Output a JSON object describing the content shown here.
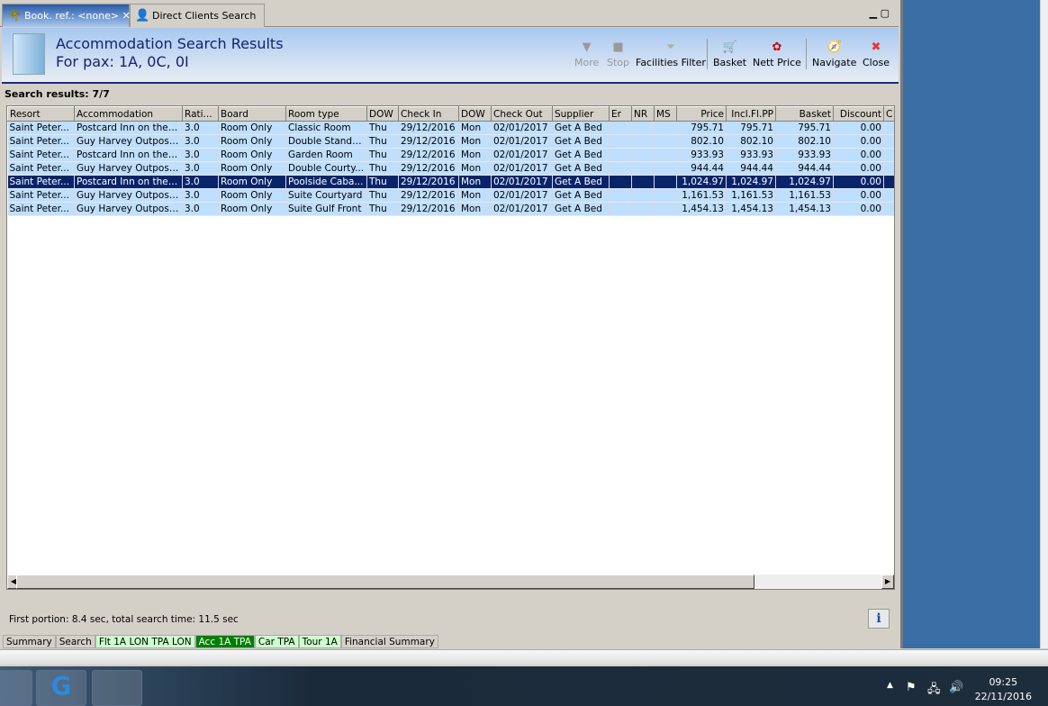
{
  "tabs": [
    {
      "label": "Book. ref.: <none>",
      "close": "✕"
    },
    {
      "label": "Direct Clients Search"
    }
  ],
  "header": {
    "title": "Accommodation Search Results",
    "subtitle": "For pax: 1A, 0C, 0I"
  },
  "toolbar": {
    "more": "More",
    "stop": "Stop",
    "facilities": "Facilities Filter",
    "basket": "Basket",
    "nett": "Nett Price",
    "navigate": "Navigate",
    "close": "Close"
  },
  "results_label": "Search results: 7/7",
  "columns": [
    "Resort",
    "Accommodation",
    "Rati...",
    "Board",
    "Room type",
    "DOW",
    "Check In",
    "DOW",
    "Check Out",
    "Supplier",
    "Er",
    "NR",
    "MS",
    "Price",
    "Incl.Fl.PP",
    "Basket",
    "Discount",
    "C"
  ],
  "rows": [
    [
      "Saint Peter...",
      "Postcard Inn on the ...",
      "3.0",
      "Room Only",
      "Classic Room",
      "Thu",
      "29/12/2016",
      "Mon",
      "02/01/2017",
      "Get A Bed",
      "",
      "",
      "",
      "795.71",
      "795.71",
      "795.71",
      "0.00",
      ""
    ],
    [
      "Saint Peter...",
      "Guy Harvey Outpost ...",
      "3.0",
      "Room Only",
      "Double Standard",
      "Thu",
      "29/12/2016",
      "Mon",
      "02/01/2017",
      "Get A Bed",
      "",
      "",
      "",
      "802.10",
      "802.10",
      "802.10",
      "0.00",
      ""
    ],
    [
      "Saint Peter...",
      "Postcard Inn on the ...",
      "3.0",
      "Room Only",
      "Garden Room",
      "Thu",
      "29/12/2016",
      "Mon",
      "02/01/2017",
      "Get A Bed",
      "",
      "",
      "",
      "933.93",
      "933.93",
      "933.93",
      "0.00",
      ""
    ],
    [
      "Saint Peter...",
      "Guy Harvey Outpost ...",
      "3.0",
      "Room Only",
      "Double Courty...",
      "Thu",
      "29/12/2016",
      "Mon",
      "02/01/2017",
      "Get A Bed",
      "",
      "",
      "",
      "944.44",
      "944.44",
      "944.44",
      "0.00",
      ""
    ],
    [
      "Saint Peter...",
      "Postcard Inn on the ...",
      "3.0",
      "Room Only",
      "Poolside Caba...",
      "Thu",
      "29/12/2016",
      "Mon",
      "02/01/2017",
      "Get A Bed",
      "",
      "",
      "",
      "1,024.97",
      "1,024.97",
      "1,024.97",
      "0.00",
      ""
    ],
    [
      "Saint Peter...",
      "Guy Harvey Outpost ...",
      "3.0",
      "Room Only",
      "Suite Courtyard",
      "Thu",
      "29/12/2016",
      "Mon",
      "02/01/2017",
      "Get A Bed",
      "",
      "",
      "",
      "1,161.53",
      "1,161.53",
      "1,161.53",
      "0.00",
      ""
    ],
    [
      "Saint Peter...",
      "Guy Harvey Outpost ...",
      "3.0",
      "Room Only",
      "Suite Gulf Front",
      "Thu",
      "29/12/2016",
      "Mon",
      "02/01/2017",
      "Get A Bed",
      "",
      "",
      "",
      "1,454.13",
      "1,454.13",
      "1,454.13",
      "0.00",
      ""
    ]
  ],
  "selected_row": 4,
  "status": "First portion: 8.4 sec, total search time: 11.5 sec",
  "info_label": "i",
  "bottom_tabs": [
    {
      "label": "Summary",
      "color": "#d4d0c8"
    },
    {
      "label": "Search",
      "color": "#d4d0c8"
    },
    {
      "label": "Flt 1A LON TPA LON",
      "color": "#ccffcc"
    },
    {
      "label": "Acc 1A TPA",
      "color": "#008000",
      "active": true
    },
    {
      "label": "Car TPA",
      "color": "#ccffcc"
    },
    {
      "label": "Tour 1A",
      "color": "#ccffcc"
    },
    {
      "label": "Financial Summary",
      "color": "#d4d0c8"
    }
  ],
  "clock": {
    "time": "09:25",
    "date": "22/11/2016"
  }
}
